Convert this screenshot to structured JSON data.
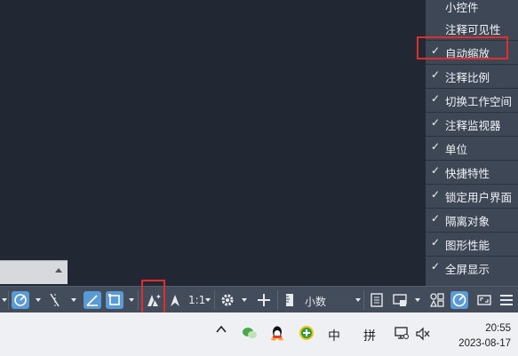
{
  "menu": {
    "header": "小控件",
    "items": [
      {
        "label": "注释可见性",
        "checked": false
      },
      {
        "label": "自动缩放",
        "checked": true
      },
      {
        "label": "注释比例",
        "checked": true
      },
      {
        "label": "切换工作空间",
        "checked": true
      },
      {
        "label": "注释监视器",
        "checked": true
      },
      {
        "label": "单位",
        "checked": true
      },
      {
        "label": "快捷特性",
        "checked": true
      },
      {
        "label": "锁定用户界面",
        "checked": true
      },
      {
        "label": "隔离对象",
        "checked": true
      },
      {
        "label": "图形性能",
        "checked": true
      },
      {
        "label": "全屏显示",
        "checked": true
      }
    ],
    "check_glyph": "✓"
  },
  "statusbar": {
    "annotation_scale": "1:1",
    "units": "小数"
  },
  "taskbar": {
    "ime_chinese": "中",
    "ime_pinyin": "拼",
    "time": "20:55",
    "date": "2023-08-17"
  },
  "colors": {
    "canvas": "#212733",
    "menu_bg": "#3e4756",
    "highlight": "#e32d2d",
    "accent_blue": "#5b9bd5"
  }
}
